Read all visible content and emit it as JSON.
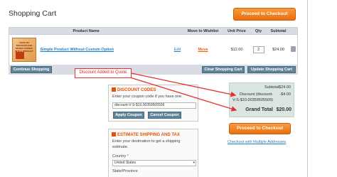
{
  "page": {
    "title": "Shopping Cart"
  },
  "header": {
    "checkout_label": "Proceed to Checkout"
  },
  "cart_table": {
    "columns": [
      "Product Name",
      "Move to Wishlist",
      "Unit Price",
      "Qty",
      "Subtotal"
    ],
    "rows": [
      {
        "thumb_text": "I WISH MY BROTHER HAD NEVER TURNED INTO A PRODUCT",
        "name": "Simple Product Without Custom Option",
        "edit": "Edit",
        "move": "Move",
        "unit_price": "$12.00",
        "qty": "2",
        "subtotal": "$24.00"
      }
    ]
  },
  "cart_actions": {
    "continue": "Continue Shopping",
    "clear": "Clear Shopping Cart",
    "update": "Update Shopping Cart"
  },
  "annotation": {
    "text": "Discount Added to Quote",
    "color": "#e53030"
  },
  "discount": {
    "title": "DISCOUNT CODES",
    "desc": "Enter your coupon code if you have one.",
    "value": "discount-V-S-$10.00359505509",
    "apply": "Apply Coupon",
    "cancel": "Cancel Coupon"
  },
  "shipping": {
    "title": "ESTIMATE SHIPPING AND TAX",
    "desc": "Enter your destination to get a shipping estimate.",
    "country_label": "Country",
    "required_mark": "*",
    "country_value": "United States",
    "state_label": "State/Province"
  },
  "totals": {
    "subtotal_label": "Subtotal",
    "subtotal_value": "$24.00",
    "discount_label_1": "Discount (discount-",
    "discount_label_2": "V-S-$10.00359505509)",
    "discount_value": "-$4.00",
    "grand_label": "Grand Total",
    "grand_value": "$20.00",
    "checkout_label": "Proceed to Checkout",
    "multi_link": "Checkout with Multiple Addresses"
  },
  "colors": {
    "accent": "#e86f0e",
    "link": "#1e7ec8",
    "button_blue": "#618499",
    "totals_bg": "#dbe6e3"
  },
  "icons": {
    "discount": "tag-icon",
    "shipping": "truck-icon",
    "delete": "trash-icon",
    "dropdown": "chevron-down-icon"
  }
}
